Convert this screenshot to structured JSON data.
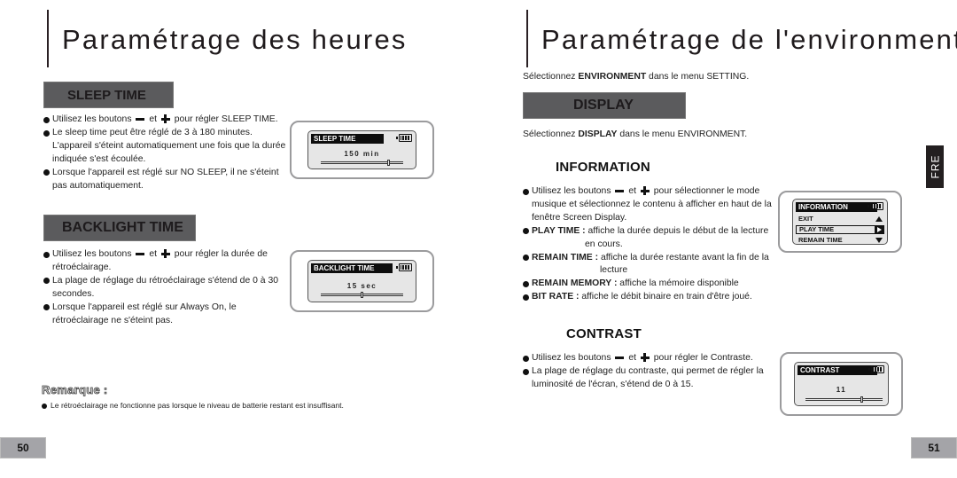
{
  "left_page": {
    "title": "Paramétrage des heures",
    "sleep_time": {
      "header": "SLEEP TIME",
      "bullets": [
        {
          "pre": "Utilisez les boutons",
          "mid": "et",
          "post": "pour régler SLEEP TIME."
        },
        {
          "text": "Le sleep time peut être réglé de 3 à 180 minutes. L'appareil s'éteint automatiquement une fois que la durée indiquée s'est écoulée."
        },
        {
          "text": "Lorsque l'appareil est réglé sur NO SLEEP, il ne s'éteint pas automatiquement."
        }
      ],
      "screen": {
        "title": "SLEEP TIME",
        "value": "150 min",
        "level_fraction": 0.83
      }
    },
    "backlight_time": {
      "header": "BACKLIGHT TIME",
      "bullets": [
        {
          "pre": "Utilisez les boutons",
          "mid": "et",
          "post": "pour régler la durée de rétroéclairage."
        },
        {
          "text": "La plage de réglage du rétroéclairage s'étend de 0 à 30 secondes."
        },
        {
          "text": "Lorsque l'appareil est réglé sur Always On, le rétroéclairage ne s'éteint pas."
        }
      ],
      "screen": {
        "title": "BACKLIGHT TIME",
        "value": "15 sec",
        "level_fraction": 0.5
      }
    },
    "remark": {
      "title": "Remarque :",
      "text": "Le rétroéclairage ne fonctionne pas lorsque le niveau de batterie restant est insuffisant."
    },
    "page_number": "50"
  },
  "right_page": {
    "title": "Paramétrage de l'environment",
    "intro": {
      "pre": "Sélectionnez ",
      "bold": "ENVIRONMENT",
      "post": " dans le menu SETTING."
    },
    "display": {
      "header": "DISPLAY",
      "intro": {
        "pre": "Sélectionnez ",
        "bold": "DISPLAY",
        "post": " dans le menu ENVIRONMENT."
      }
    },
    "information": {
      "header": "INFORMATION",
      "bullets": [
        {
          "pre": "Utilisez les boutons",
          "mid": "et",
          "post": "pour sélectionner le mode musique et sélectionnez le contenu à afficher en haut de la fenêtre Screen Display."
        },
        {
          "bold": "PLAY TIME :",
          "text": "affiche la durée depuis le début de la lecture",
          "cont": "en cours."
        },
        {
          "bold": "REMAIN TIME :",
          "text": "affiche la durée restante avant la fin de la",
          "cont": "lecture"
        },
        {
          "bold": "REMAIN MEMORY :",
          "text": "affiche la mémoire disponible"
        },
        {
          "bold": "BIT RATE :",
          "text": "affiche le débit binaire en train d'être joué."
        }
      ],
      "screen": {
        "title": "INFORMATION",
        "items": [
          "EXIT",
          "PLAY TIME",
          "REMAIN TIME"
        ],
        "selected": "PLAY TIME"
      }
    },
    "contrast": {
      "header": "CONTRAST",
      "bullets": [
        {
          "pre": "Utilisez les boutons",
          "mid": "et",
          "post": "pour régler le Contraste."
        },
        {
          "text": "La plage de réglage du contraste, qui permet de régler la luminosité de l'écran, s'étend de 0 à 15."
        }
      ],
      "screen": {
        "title": "CONTRAST",
        "value": "11",
        "level_fraction": 0.73
      }
    },
    "language_tab": "FRE",
    "page_number": "51"
  }
}
